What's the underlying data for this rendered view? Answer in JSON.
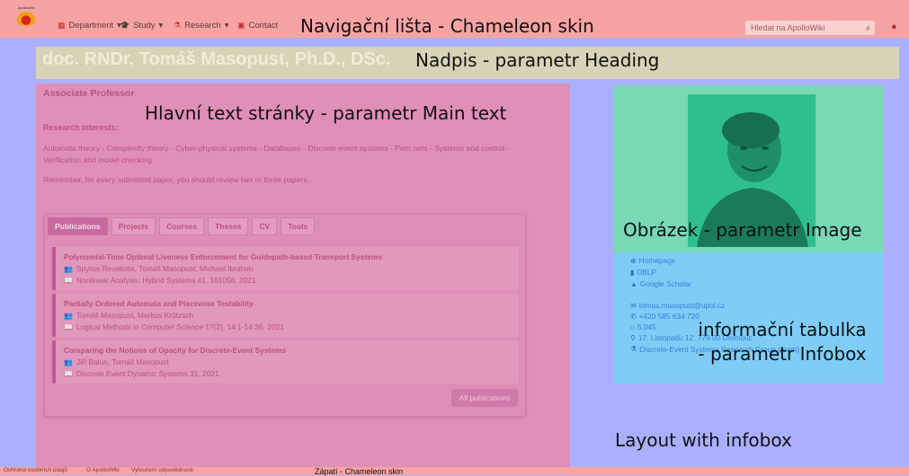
{
  "navbar": {
    "logo_text": "ApolloWiki",
    "items": [
      {
        "label": "Department",
        "icon": "building-icon",
        "glyph": "▦",
        "caret": "▾"
      },
      {
        "label": "Study",
        "icon": "graduation-cap-icon",
        "glyph": "🎓",
        "caret": "▾"
      },
      {
        "label": "Research",
        "icon": "flask-icon",
        "glyph": "⚗",
        "caret": "▾"
      },
      {
        "label": "Contact",
        "icon": "contact-icon",
        "glyph": "▣",
        "caret": ""
      }
    ],
    "overlay_label": "Navigační lišta - Chameleon skin",
    "search_placeholder": "Hledat na ApolloWiki"
  },
  "heading": {
    "name": "doc. RNDr. Tomáš Masopust, Ph.D., DSc.",
    "overlay_label": "Nadpis - parametr Heading"
  },
  "main": {
    "title": "Associate Professor",
    "overlay_label": "Hlavní text stránky - parametr Main text",
    "research_label": "Research interests:",
    "research_text": "Automata theory - Complexity theory - Cyber-physical systems - Databases - Discrete-event systems - Petri nets - Systems and control - Verification and model checking",
    "reminder": "Remember, for every submitted paper, you should review two or three papers.",
    "tabs": [
      "Publications",
      "Projects",
      "Courses",
      "Theses",
      "CV",
      "Tools"
    ],
    "publications": [
      {
        "title": "Polynomial-Time Optimal Liveness Enforcement for Guidepath-based Transport Systems",
        "authors": "Spyros Reveliotis, Tomáš Masopust, Michael Ibrahim",
        "venue": "Nonlinear Analysis: Hybrid Systems 41, 101058, 2021"
      },
      {
        "title": "Partially Ordered Automata and Piecewise Testability",
        "authors": "Tomáš Masopust, Markus Krötzsch",
        "venue": "Logical Methods in Computer Science 17(2), 14:1-14:36, 2021"
      },
      {
        "title": "Comparing the Notions of Opacity for Discrete-Event Systems",
        "authors": "Jiří Balun, Tomáš Masopust",
        "venue": "Discrete Event Dynamic Systems 31, 2021"
      }
    ],
    "all_publications": "All publications"
  },
  "image": {
    "overlay_label": "Obrázek - parametr Image"
  },
  "infobox": {
    "links": [
      "Homepage",
      "DBLP",
      "Google Scholar"
    ],
    "contact": [
      {
        "text": "tomas.masopust@upol.cz",
        "icon": "envelope-icon",
        "glyph": "✉"
      },
      {
        "text": "+420 585 634 720",
        "icon": "phone-icon",
        "glyph": "✆"
      },
      {
        "text": "5.045",
        "icon": "home-icon",
        "glyph": "⌂"
      },
      {
        "text": "17. Listopadu 12, 779 00 Olomouc",
        "icon": "map-marker-icon",
        "glyph": "⚲"
      },
      {
        "text": "Discrete-Event Systems Research Group (team)",
        "icon": "flask-icon",
        "glyph": "⚗"
      }
    ],
    "overlay_label_1": "informační tabulka",
    "overlay_label_2": "- parametr Infobox"
  },
  "layout_label": "Layout with infobox",
  "footer": {
    "links": [
      "Ochrana osobních údajů",
      "O ApolloWiki",
      "Vyloučení odpovědnosti"
    ],
    "overlay_label": "Zápatí - Chameleon skin"
  },
  "colors": {
    "navbar": "#f7a3a3",
    "heading_band": "#d9d2b6",
    "main": "#e08fb9",
    "image": "#7ad9b5",
    "infobox": "#7fcdf6",
    "layout": "#aab0ff"
  }
}
